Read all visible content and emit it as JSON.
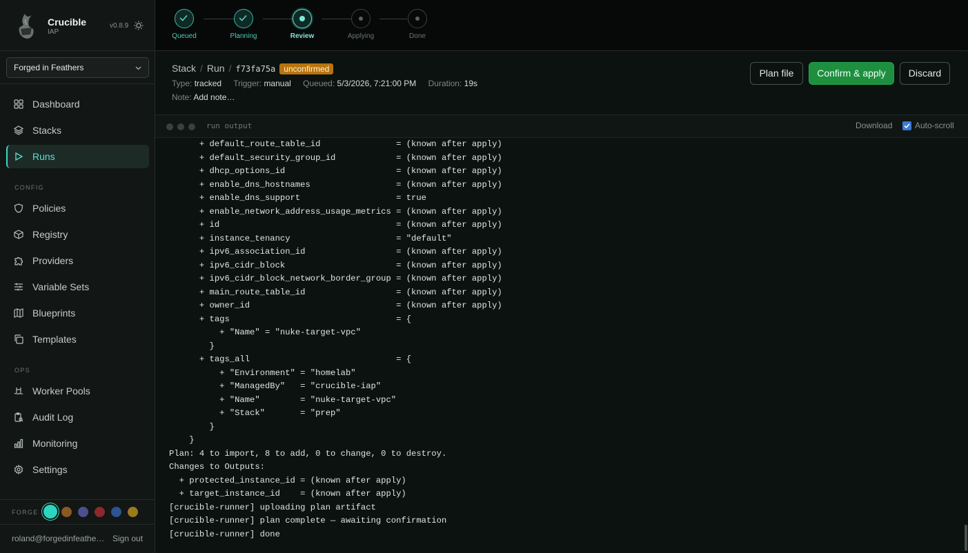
{
  "brand": {
    "name": "Crucible",
    "subtitle": "IAP",
    "version": "v0.8.9"
  },
  "org": {
    "selected": "Forged in Feathers"
  },
  "nav": {
    "main": [
      {
        "label": "Dashboard",
        "icon": "grid-icon"
      },
      {
        "label": "Stacks",
        "icon": "layers-icon"
      },
      {
        "label": "Runs",
        "icon": "play-icon",
        "active": true
      }
    ],
    "config_label": "CONFIG",
    "config": [
      {
        "label": "Policies",
        "icon": "shield-icon"
      },
      {
        "label": "Registry",
        "icon": "box-icon"
      },
      {
        "label": "Providers",
        "icon": "puzzle-icon"
      },
      {
        "label": "Variable Sets",
        "icon": "sliders-icon"
      },
      {
        "label": "Blueprints",
        "icon": "map-icon"
      },
      {
        "label": "Templates",
        "icon": "copy-icon"
      }
    ],
    "ops_label": "OPS",
    "ops": [
      {
        "label": "Worker Pools",
        "icon": "pool-icon"
      },
      {
        "label": "Audit Log",
        "icon": "audit-icon"
      },
      {
        "label": "Monitoring",
        "icon": "bar-chart-icon"
      },
      {
        "label": "Settings",
        "icon": "gear-icon"
      }
    ]
  },
  "forge": {
    "label": "FORGE",
    "swatches": [
      "#2dd4bf",
      "#8a5a22",
      "#4b4f8f",
      "#8a2a2a",
      "#2a5590",
      "#9a7a1c"
    ]
  },
  "user": {
    "email": "roland@forgedinfeathers.com",
    "signout": "Sign out"
  },
  "steps": [
    {
      "label": "Queued",
      "state": "done"
    },
    {
      "label": "Planning",
      "state": "done"
    },
    {
      "label": "Review",
      "state": "current"
    },
    {
      "label": "Applying",
      "state": "pending"
    },
    {
      "label": "Done",
      "state": "pending"
    }
  ],
  "run": {
    "crumb_stack": "Stack",
    "crumb_run": "Run",
    "id": "f73fa75a",
    "status": "unconfirmed",
    "type_key": "Type:",
    "type": "tracked",
    "trigger_key": "Trigger:",
    "trigger": "manual",
    "queued_key": "Queued:",
    "queued": "5/3/2026, 7:21:00 PM",
    "duration_key": "Duration:",
    "duration": "19s",
    "note_key": "Note:",
    "note_placeholder": "Add note…"
  },
  "actions": {
    "plan_file": "Plan file",
    "confirm": "Confirm & apply",
    "discard": "Discard"
  },
  "terminal": {
    "title": "run output",
    "download": "Download",
    "autoscroll": "Auto-scroll",
    "lines": [
      "      + default_route_table_id               = (known after apply)",
      "      + default_security_group_id            = (known after apply)",
      "      + dhcp_options_id                      = (known after apply)",
      "      + enable_dns_hostnames                 = (known after apply)",
      "      + enable_dns_support                   = true",
      "      + enable_network_address_usage_metrics = (known after apply)",
      "      + id                                   = (known after apply)",
      "      + instance_tenancy                     = \"default\"",
      "      + ipv6_association_id                  = (known after apply)",
      "      + ipv6_cidr_block                      = (known after apply)",
      "      + ipv6_cidr_block_network_border_group = (known after apply)",
      "      + main_route_table_id                  = (known after apply)",
      "      + owner_id                             = (known after apply)",
      "      + tags                                 = {",
      "          + \"Name\" = \"nuke-target-vpc\"",
      "        }",
      "      + tags_all                             = {",
      "          + \"Environment\" = \"homelab\"",
      "          + \"ManagedBy\"   = \"crucible-iap\"",
      "          + \"Name\"        = \"nuke-target-vpc\"",
      "          + \"Stack\"       = \"prep\"",
      "        }",
      "    }",
      "Plan: 4 to import, 8 to add, 0 to change, 0 to destroy.",
      "Changes to Outputs:",
      "  + protected_instance_id = (known after apply)",
      "  + target_instance_id    = (known after apply)",
      "[crucible-runner] uploading plan artifact",
      "[crucible-runner] plan complete — awaiting confirmation",
      "[crucible-runner] done"
    ]
  }
}
